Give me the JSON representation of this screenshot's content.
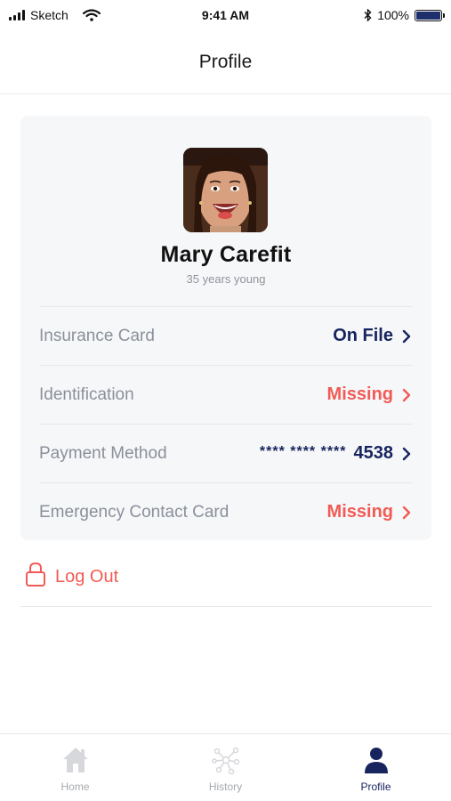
{
  "status_bar": {
    "carrier": "Sketch",
    "time": "9:41 AM",
    "battery": "100%"
  },
  "nav": {
    "title": "Profile"
  },
  "profile": {
    "name": "Mary Carefit",
    "age_text": "35 years young"
  },
  "rows": [
    {
      "label": "Insurance Card",
      "value": "On File",
      "status": "navy"
    },
    {
      "label": "Identification",
      "value": "Missing",
      "status": "red"
    },
    {
      "label": "Payment Method",
      "masked": "**** **** ****",
      "value": "4538",
      "status": "navy"
    },
    {
      "label": "Emergency Contact Card",
      "value": "Missing",
      "status": "red"
    }
  ],
  "logout": {
    "label": "Log Out",
    "icon": "lock-icon"
  },
  "tabs": [
    {
      "label": "Home",
      "icon": "home-icon",
      "active": false
    },
    {
      "label": "History",
      "icon": "history-network-icon",
      "active": false
    },
    {
      "label": "Profile",
      "icon": "person-icon",
      "active": true
    }
  ],
  "colors": {
    "navy": "#17245e",
    "red": "#f25a55",
    "muted": "#8a909b",
    "card_bg": "#f6f7f9"
  }
}
